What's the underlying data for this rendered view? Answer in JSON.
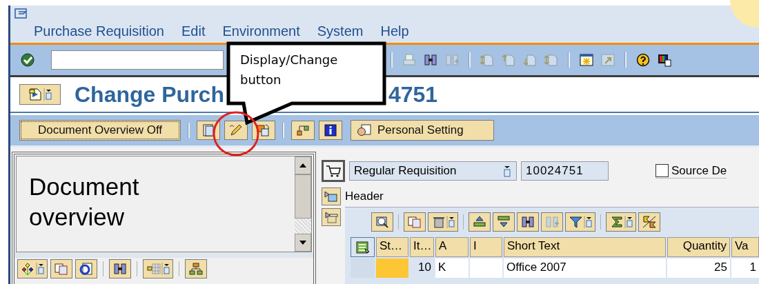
{
  "menu_bar": {
    "items": [
      "Purchase Requisition",
      "Edit",
      "Environment",
      "System",
      "Help"
    ]
  },
  "screen_title": {
    "visible_parts": [
      "Change Purch",
      "4751"
    ]
  },
  "app_toolbar": {
    "overview_button": {
      "label": "Document Overview Off"
    },
    "personal_setting_button": {
      "label": "Personal Setting"
    }
  },
  "callout": {
    "text": "Display/Change button"
  },
  "document_overview": {
    "title": "Document overview"
  },
  "requisition": {
    "type_field": {
      "value": "Regular Requisition"
    },
    "number_field": {
      "value": "10024751"
    },
    "source_checkbox": {
      "label": "Source De",
      "checked": false
    }
  },
  "header_tab": {
    "label": "Header"
  },
  "items_table": {
    "columns": [
      "St…",
      "It…",
      "A",
      "I",
      "Short Text",
      "Quantity",
      "Va"
    ],
    "rows": [
      {
        "color": "#fcc634",
        "item": "10",
        "account": "K",
        "short_text": "Office 2007",
        "quantity": "25",
        "column_7": "1"
      }
    ]
  }
}
